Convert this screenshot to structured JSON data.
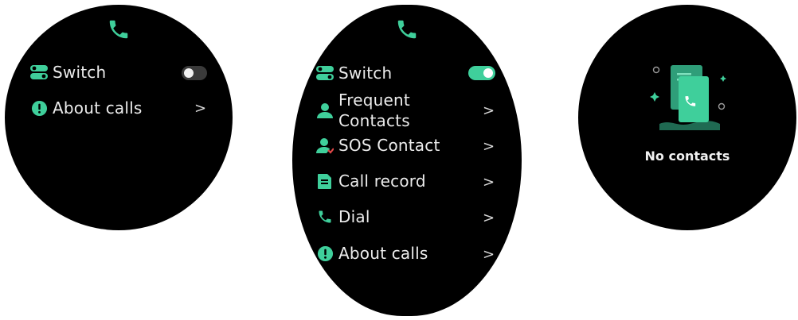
{
  "colors": {
    "accent": "#3fcf9b",
    "screen_bg": "#000000",
    "page_bg": "#ffffff"
  },
  "screen1": {
    "icon": "phone-icon",
    "items": [
      {
        "icon": "switch-icon",
        "label": "Switch",
        "control": "toggle",
        "toggle_state": "off"
      },
      {
        "icon": "info-icon",
        "label": "About calls",
        "control": "chevron",
        "chevron": ">"
      }
    ]
  },
  "screen2": {
    "icon": "phone-icon",
    "switch": {
      "label": "Switch",
      "toggle_state": "on"
    },
    "frequent": {
      "line1": "Frequent",
      "line2": "Contacts",
      "chevron": ">"
    },
    "sos": {
      "label": "SOS Contact",
      "chevron": ">"
    },
    "record": {
      "label": "Call record",
      "chevron": ">"
    },
    "dial": {
      "label": "Dial",
      "chevron": ">"
    },
    "about": {
      "label": "About calls",
      "chevron": ">"
    }
  },
  "screen3": {
    "illustration": "contacts-card-icon",
    "empty_text": "No contacts"
  }
}
